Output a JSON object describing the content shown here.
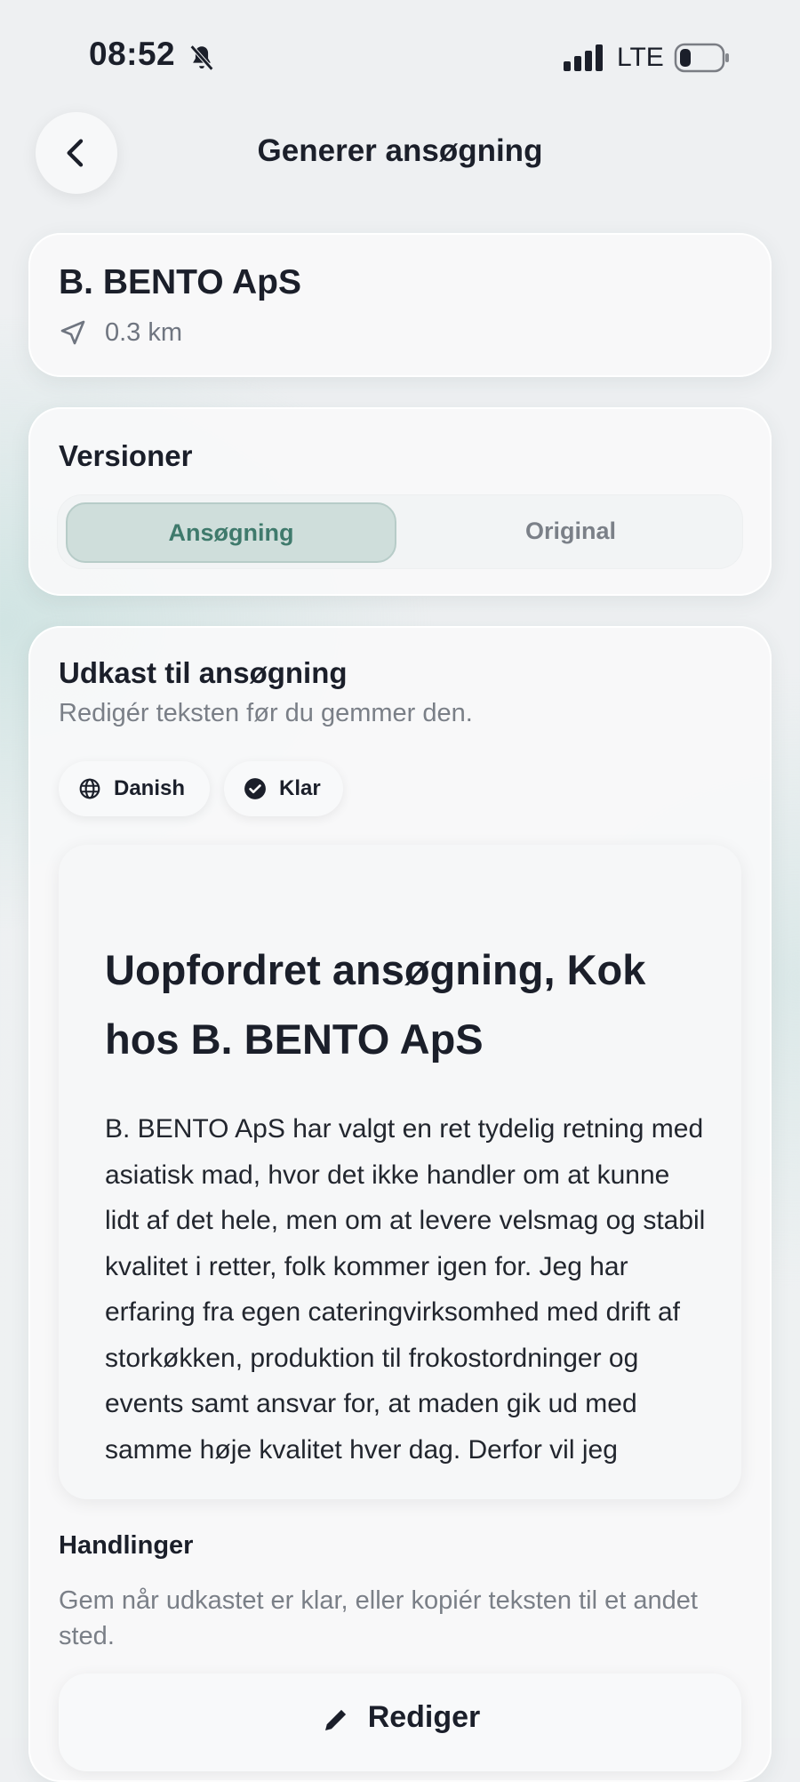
{
  "status_bar": {
    "time": "08:52",
    "network": "LTE"
  },
  "header": {
    "title": "Generer ansøgning"
  },
  "company": {
    "name": "B. BENTO ApS",
    "distance": "0.3 km"
  },
  "versions": {
    "title": "Versioner",
    "segments": [
      {
        "label": "Ansøgning",
        "active": true
      },
      {
        "label": "Original",
        "active": false
      }
    ]
  },
  "draft": {
    "title": "Udkast til ansøgning",
    "subtitle": "Redigér teksten før du gemmer den.",
    "chips": [
      {
        "label": "Danish",
        "icon": "globe-icon"
      },
      {
        "label": "Klar",
        "icon": "check-circle-icon"
      }
    ],
    "document": {
      "heading": "Uopfordret ansøgning, Kok hos B. BENTO ApS",
      "body": "B. BENTO ApS har valgt en ret tydelig retning med asiatisk mad, hvor det ikke handler om at kunne lidt af det hele, men om at levere velsmag og stabil kvalitet i retter, folk kommer igen for. Jeg har erfaring fra egen cateringvirksomhed med drift af storkøkken, produktion til frokostordninger og events samt ansvar for, at maden gik ud med samme høje kvalitet hver dag. Derfor vil jeg"
    }
  },
  "actions": {
    "title": "Handlinger",
    "subtitle": "Gem når udkastet er klar, eller kopiér teksten til et andet sted.",
    "edit_label": "Rediger"
  },
  "colors": {
    "accent": "#3f7a6c",
    "accent_bg": "#cfdedb"
  }
}
